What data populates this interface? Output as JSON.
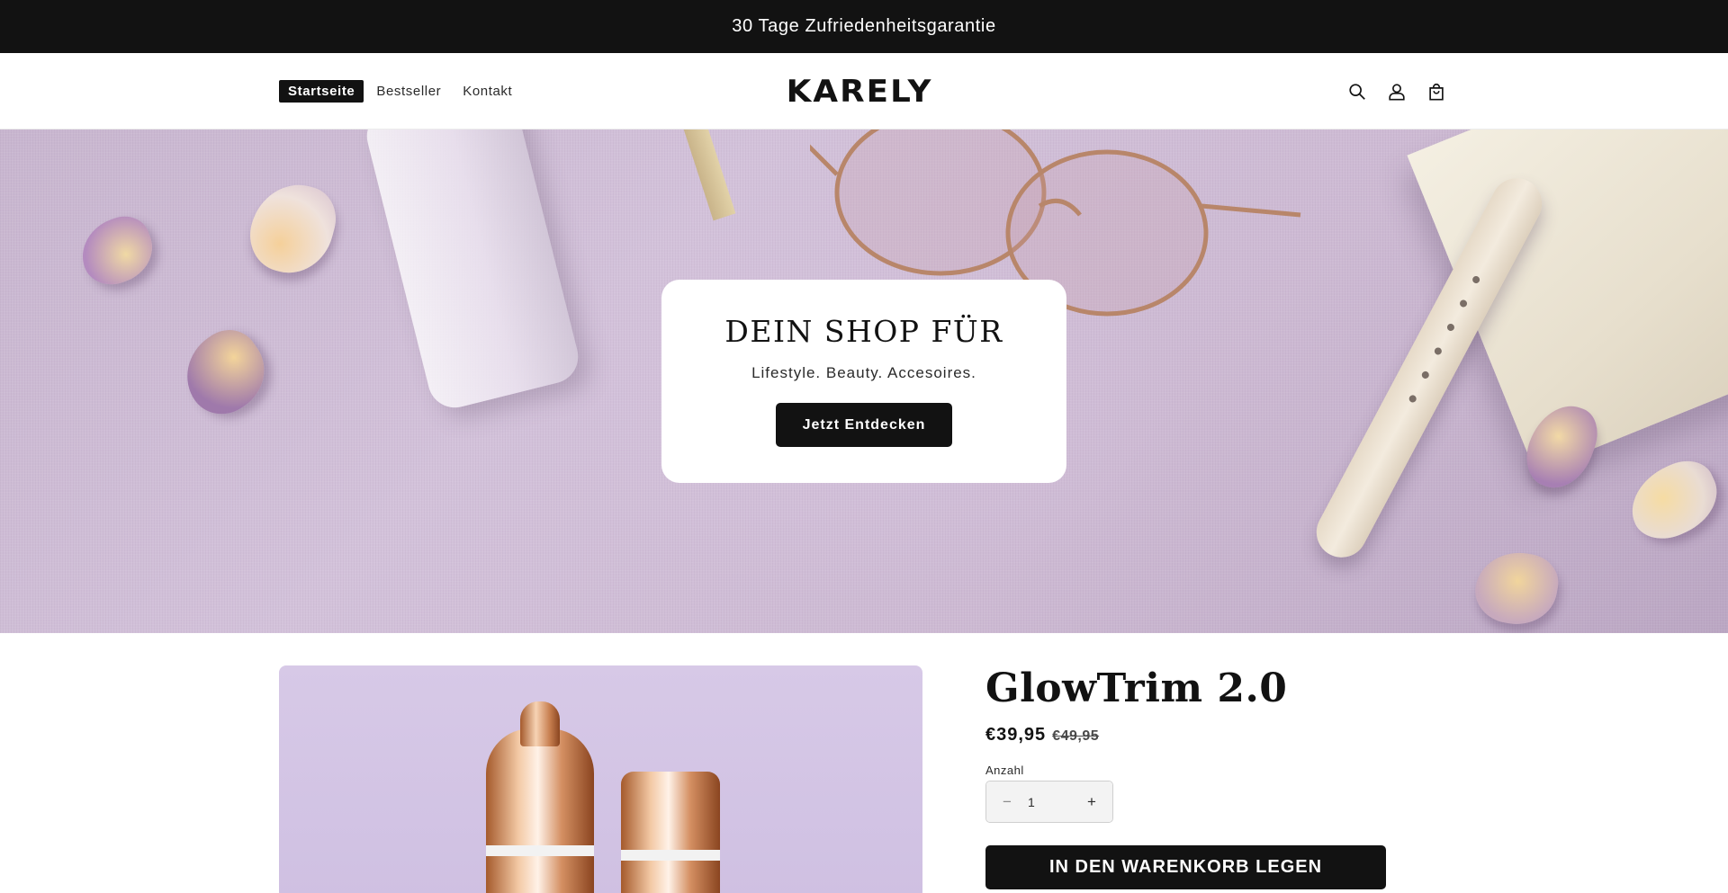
{
  "announcement": {
    "text": "30 Tage Zufriedenheitsgarantie"
  },
  "header": {
    "nav": [
      {
        "label": "Startseite",
        "active": true
      },
      {
        "label": "Bestseller",
        "active": false
      },
      {
        "label": "Kontakt",
        "active": false
      }
    ],
    "logo": "KARELY",
    "icons": [
      "search-icon",
      "account-icon",
      "cart-icon"
    ]
  },
  "hero": {
    "title": "DEIN SHOP FÜR",
    "subtitle": "Lifestyle. Beauty. Accesoires.",
    "button_label": "Jetzt Entdecken"
  },
  "product": {
    "title": "GlowTrim 2.0",
    "price": "€39,95",
    "compare_price": "€49,95",
    "quantity_label": "Anzahl",
    "quantity_value": "1",
    "decrease_symbol": "−",
    "increase_symbol": "+",
    "add_to_cart_label": "IN DEN WARENKORB LEGEN"
  },
  "colors": {
    "primary": "#121212",
    "background": "#ffffff",
    "hero_lavender": "#cdbad3",
    "product_bg": "#d3c5e5"
  }
}
